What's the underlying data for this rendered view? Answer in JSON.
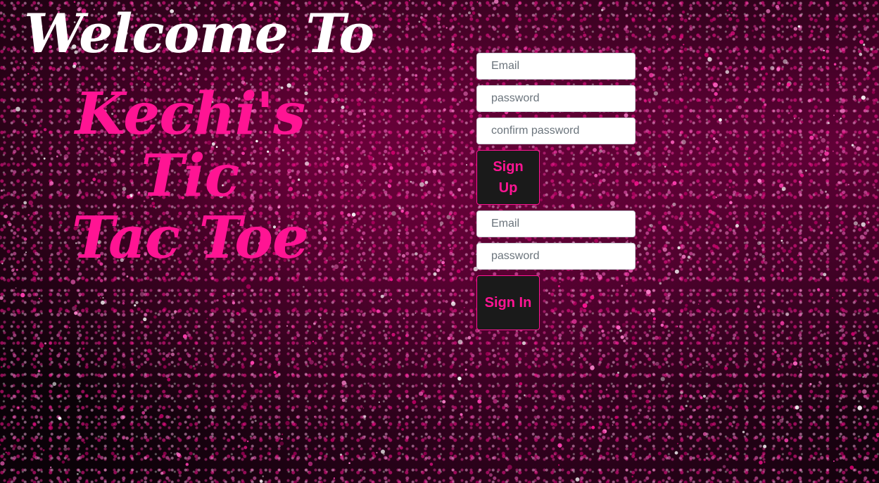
{
  "heading": {
    "welcome": "Welcome To",
    "title_line1": "Kechi's Tic",
    "title_line2": "Tac Toe"
  },
  "sign_up": {
    "email_placeholder": "Email",
    "password_placeholder": "password",
    "confirm_placeholder": "confirm password",
    "button_label": "Sign Up"
  },
  "sign_in": {
    "email_placeholder": "Email",
    "password_placeholder": "password",
    "button_label": "Sign In"
  },
  "colors": {
    "accent": "#ff1493",
    "background": "#0b0208",
    "button_bg": "#1a1a1a"
  }
}
